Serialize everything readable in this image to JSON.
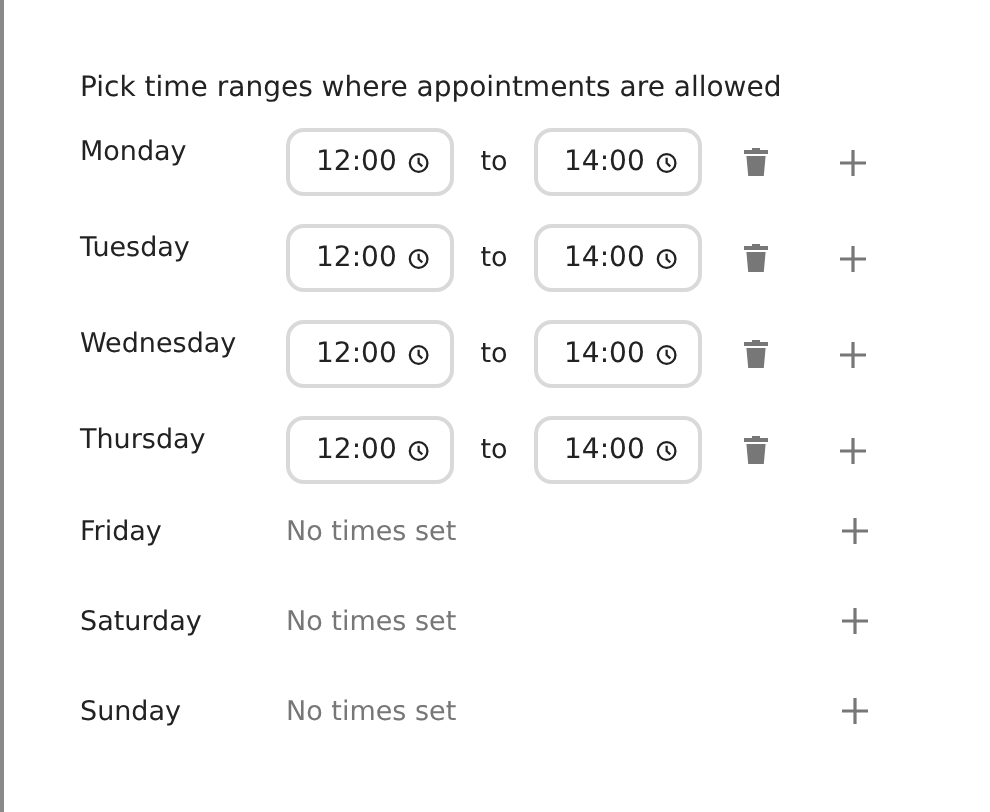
{
  "heading": "Pick time ranges where appointments are allowed",
  "days": [
    {
      "name": "Monday",
      "ranges": [
        {
          "start": "12:00",
          "separator": "to",
          "end": "14:00"
        }
      ]
    },
    {
      "name": "Tuesday",
      "ranges": [
        {
          "start": "12:00",
          "separator": "to",
          "end": "14:00"
        }
      ]
    },
    {
      "name": "Wednesday",
      "ranges": [
        {
          "start": "12:00",
          "separator": "to",
          "end": "14:00"
        }
      ]
    },
    {
      "name": "Thursday",
      "ranges": [
        {
          "start": "12:00",
          "separator": "to",
          "end": "14:00"
        }
      ]
    },
    {
      "name": "Friday",
      "empty_text": "No times set"
    },
    {
      "name": "Saturday",
      "empty_text": "No times set"
    },
    {
      "name": "Sunday",
      "empty_text": "No times set"
    }
  ]
}
